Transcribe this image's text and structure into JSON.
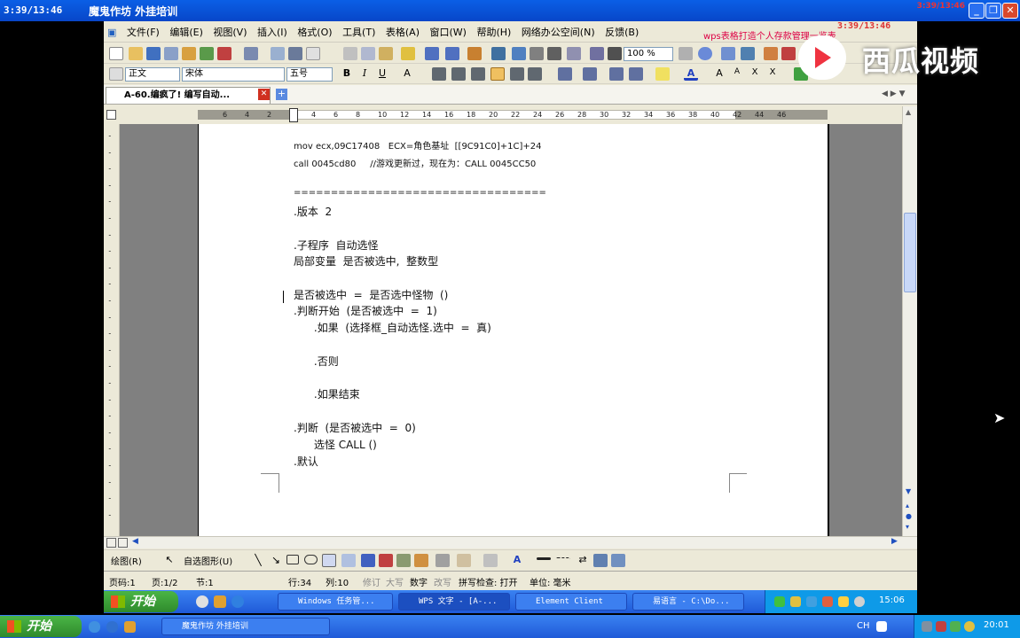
{
  "outer_window": {
    "title_time": "3:39/13:46",
    "title": "魔鬼作坊 外挂培训",
    "corner_time": "3:39/13:46"
  },
  "menu": {
    "items": [
      "文件(F)",
      "编辑(E)",
      "视图(V)",
      "插入(I)",
      "格式(O)",
      "工具(T)",
      "表格(A)",
      "窗口(W)",
      "帮助(H)",
      "网络办公空间(N)",
      "反馈(B)"
    ],
    "ad": "wps表格打造个人存款管理一览表",
    "time": "3:39/13:46"
  },
  "format_bar": {
    "style": "正文",
    "font": "宋体",
    "size": "五号",
    "zoom": "100 %"
  },
  "doc_tab": {
    "label": "A-60.编疯了! 编写自动..."
  },
  "ruler": {
    "ticks": [
      "6",
      "4",
      "2",
      "2",
      "4",
      "6",
      "8",
      "10",
      "12",
      "14",
      "16",
      "18",
      "20",
      "22",
      "24",
      "26",
      "28",
      "30",
      "32",
      "34",
      "36",
      "38",
      "40",
      "42",
      "44",
      "46"
    ]
  },
  "document": {
    "lines": [
      "mov ecx,09C17408   ECX=角色基址  [[9C91C0]+1C]+24",
      "call 0045cd80     //游戏更新过，现在为：CALL 0045CC50",
      "",
      "==================================",
      ".版本  2",
      "",
      ".子程序  自动选怪",
      "局部变量  是否被选中,  整数型",
      "",
      "是否被选中  =  是否选中怪物  ()",
      ".判断开始  (是否被选中  =  1)",
      "      .如果  (选择框_自动选怪.选中  =  真)",
      "",
      "      .否则",
      "",
      "      .如果结束",
      "",
      ".判断  (是否被选中  =  0)",
      "      选怪 CALL ()",
      ".默认"
    ]
  },
  "drawbar": {
    "draw": "绘图(R)",
    "autoshape": "自选图形(U)"
  },
  "status": {
    "page": "页码:1",
    "pages": "页:1/2",
    "section": "节:1",
    "row": "行:34",
    "col": "列:10",
    "rec": "修订",
    "caps": "大写",
    "num": "数字",
    "ovr": "改写",
    "spell": "拼写检查: 打开",
    "unit": "单位: 毫米"
  },
  "taskbar_inner": {
    "start": "开始",
    "tasks": [
      "Windows 任务管...",
      "WPS 文字 - [A-...",
      "Element Client",
      "易语言 - C:\\Do..."
    ],
    "clock": "15:06"
  },
  "taskbar_outer": {
    "start": "开始",
    "tasks": [
      "魔鬼作坊 外挂培训"
    ],
    "lang": "CH",
    "clock": "20:01"
  },
  "watermark": {
    "text": "西瓜视频"
  },
  "colors": {
    "accent": "#0a5fe6",
    "doc_bg": "#808080",
    "ad": "#d00044",
    "watermark_red": "#ef3340"
  }
}
